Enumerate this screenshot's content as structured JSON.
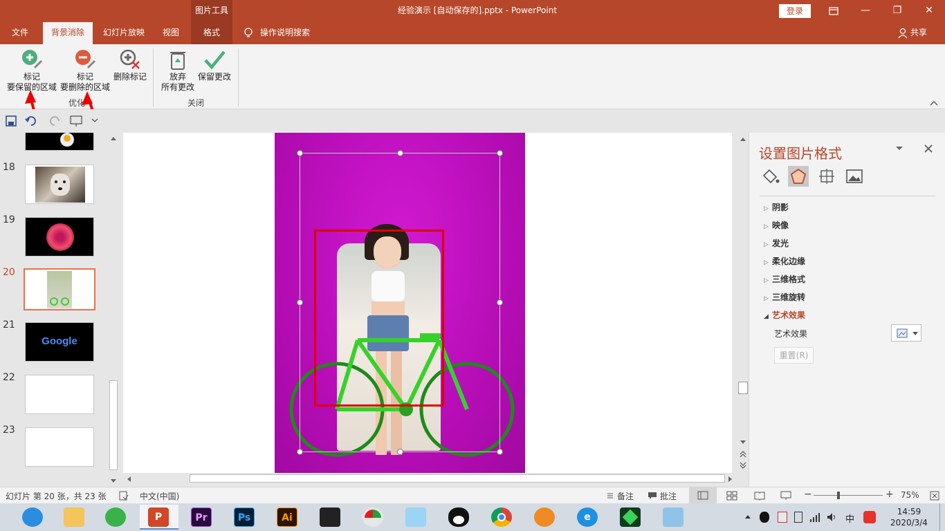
{
  "titlebar": {
    "context_group": "图片工具",
    "doc_title": "经验演示 [自动保存的].pptx  -  PowerPoint",
    "login": "登录",
    "restore_icon": "ribbon-display-icon",
    "minimize": "—",
    "maximize": "❐",
    "close": "✕"
  },
  "tabs": {
    "file": "文件",
    "background_removal": "背景消除",
    "slideshow": "幻灯片放映",
    "view": "视图",
    "format": "格式",
    "tellme": "操作说明搜索",
    "share": "共享"
  },
  "ribbon": {
    "mark_keep_line1": "标记",
    "mark_keep_line2": "要保留的区域",
    "mark_remove_line1": "标记",
    "mark_remove_line2": "要删除的区域",
    "delete_mark": "删除标记",
    "refine_group": "优化",
    "discard_line1": "放弃",
    "discard_line2": "所有更改",
    "keep_changes": "保留更改",
    "close_group": "关闭"
  },
  "slides": {
    "numbers": [
      "18",
      "19",
      "20",
      "21",
      "22",
      "23"
    ],
    "google_text": "Google"
  },
  "pane": {
    "title": "设置图片格式",
    "items": [
      "阴影",
      "映像",
      "发光",
      "柔化边缘",
      "三维格式",
      "三维旋转"
    ],
    "expanded": "艺术效果",
    "art_label": "艺术效果",
    "reset": "重置(R)"
  },
  "status": {
    "slide_info": "幻灯片 第 20 张，共 23 张",
    "language": "中文(中国)",
    "notes": "备注",
    "comments": "批注",
    "zoom": "75%"
  },
  "taskbar": {
    "pr": "Pr",
    "ps": "Ps",
    "ai": "Ai",
    "time": "14:59",
    "date": "2020/3/4",
    "ime": "中"
  },
  "colors": {
    "accent": "#b7472a",
    "selected_slide_border": "#e9714c",
    "removal_overlay": "#c40fc4",
    "marquee_red": "#e00000"
  }
}
